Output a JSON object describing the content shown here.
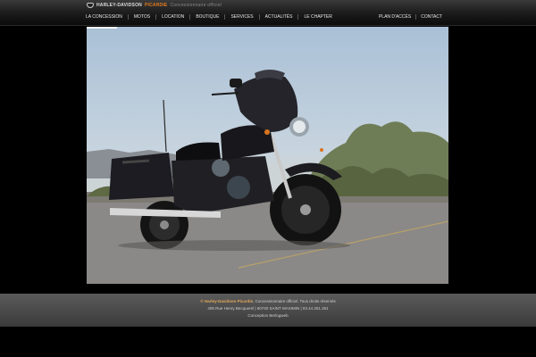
{
  "header": {
    "brand_name": "HARLEY-DAVIDSON",
    "brand_accent": "PICARDIE",
    "brand_sub": "Concessionnaire officiel",
    "logo_icon": "harley-davidson-shield-icon"
  },
  "nav": {
    "items": [
      {
        "label": "LA CONCESSION"
      },
      {
        "label": "MOTOS"
      },
      {
        "label": "LOCATION"
      },
      {
        "label": "BOUTIQUE"
      },
      {
        "label": "SERVICES"
      },
      {
        "label": "ACTUALITÉS"
      },
      {
        "label": "LE CHAPTER"
      }
    ],
    "right_items": [
      {
        "label": "PLAN D'ACCÈS"
      },
      {
        "label": "CONTACT"
      }
    ]
  },
  "hero": {
    "subject": "harley-davidson-touring-motorcycle-image"
  },
  "footer": {
    "brand": "© Harley-Davidson Picardie",
    "line1_rest": ", Concessionnaire officiel. Tous droits réservés",
    "line2": "405 Rue Henry Becquerel | 60740 SAINT MAXIMIN | 03.44.251.251",
    "line3": "Conception Berlogweb"
  },
  "colors": {
    "accent": "#e07a1f",
    "background": "#000000",
    "footer_bg": "#4a4a4a"
  }
}
